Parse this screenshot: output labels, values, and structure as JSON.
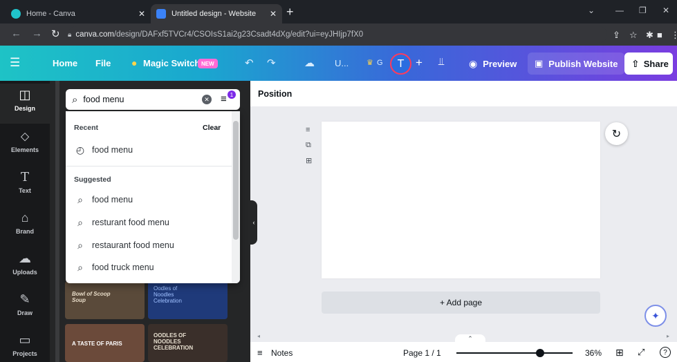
{
  "browser": {
    "tabs": [
      {
        "title": "Home - Canva",
        "active": false
      },
      {
        "title": "Untitled design - Website",
        "active": true
      }
    ],
    "new_tab": "+",
    "url_domain": "canva.com",
    "url_path": "/design/DAFxf5TVCr4/CSOIsS1ai2g23Csadt4dXg/edit?ui=eyJHIjp7fX0",
    "profile_initial": "T"
  },
  "header": {
    "home": "Home",
    "file": "File",
    "magic_switch": "Magic Switch",
    "new_badge": "NEW",
    "title_truncated": "U...",
    "collab_truncated": "G",
    "avatar_initial": "T",
    "preview": "Preview",
    "publish": "Publish Website",
    "share": "Share",
    "accent_colors": [
      "#1ec3c6",
      "#3a67d9",
      "#7a3de0"
    ]
  },
  "rail": [
    {
      "label": "Design",
      "icon": "layout-icon",
      "active": true
    },
    {
      "label": "Elements",
      "icon": "shapes-icon",
      "active": false
    },
    {
      "label": "Text",
      "icon": "text-icon",
      "active": false
    },
    {
      "label": "Brand",
      "icon": "brand-icon",
      "active": false
    },
    {
      "label": "Uploads",
      "icon": "cloud-upload-icon",
      "active": false
    },
    {
      "label": "Draw",
      "icon": "draw-icon",
      "active": false
    },
    {
      "label": "Projects",
      "icon": "folder-icon",
      "active": false
    }
  ],
  "search": {
    "value": "food menu",
    "filter_badge": "1",
    "recent_label": "Recent",
    "clear_label": "Clear",
    "recent": [
      "food menu"
    ],
    "suggested_label": "Suggested",
    "suggested": [
      "food menu",
      "resturant food menu",
      "restaurant food menu",
      "food truck menu"
    ]
  },
  "thumbnails": [
    {
      "text": "Bowl of Scoop Soup",
      "bg": "#5a4a3a"
    },
    {
      "text": "Oodles of Noodles Celebration",
      "bg": "#1f3a7a"
    },
    {
      "text": "A TASTE OF PARIS",
      "bg": "#6b4a3a"
    },
    {
      "text": "OODLES OF NOODLES CELEBRATION",
      "bg": "#3a2f2a"
    }
  ],
  "editor": {
    "position_label": "Position",
    "add_page": "+ Add page",
    "notes": "Notes",
    "page_indicator": "Page 1 / 1",
    "zoom": "36%",
    "zoom_fraction": 0.36
  }
}
